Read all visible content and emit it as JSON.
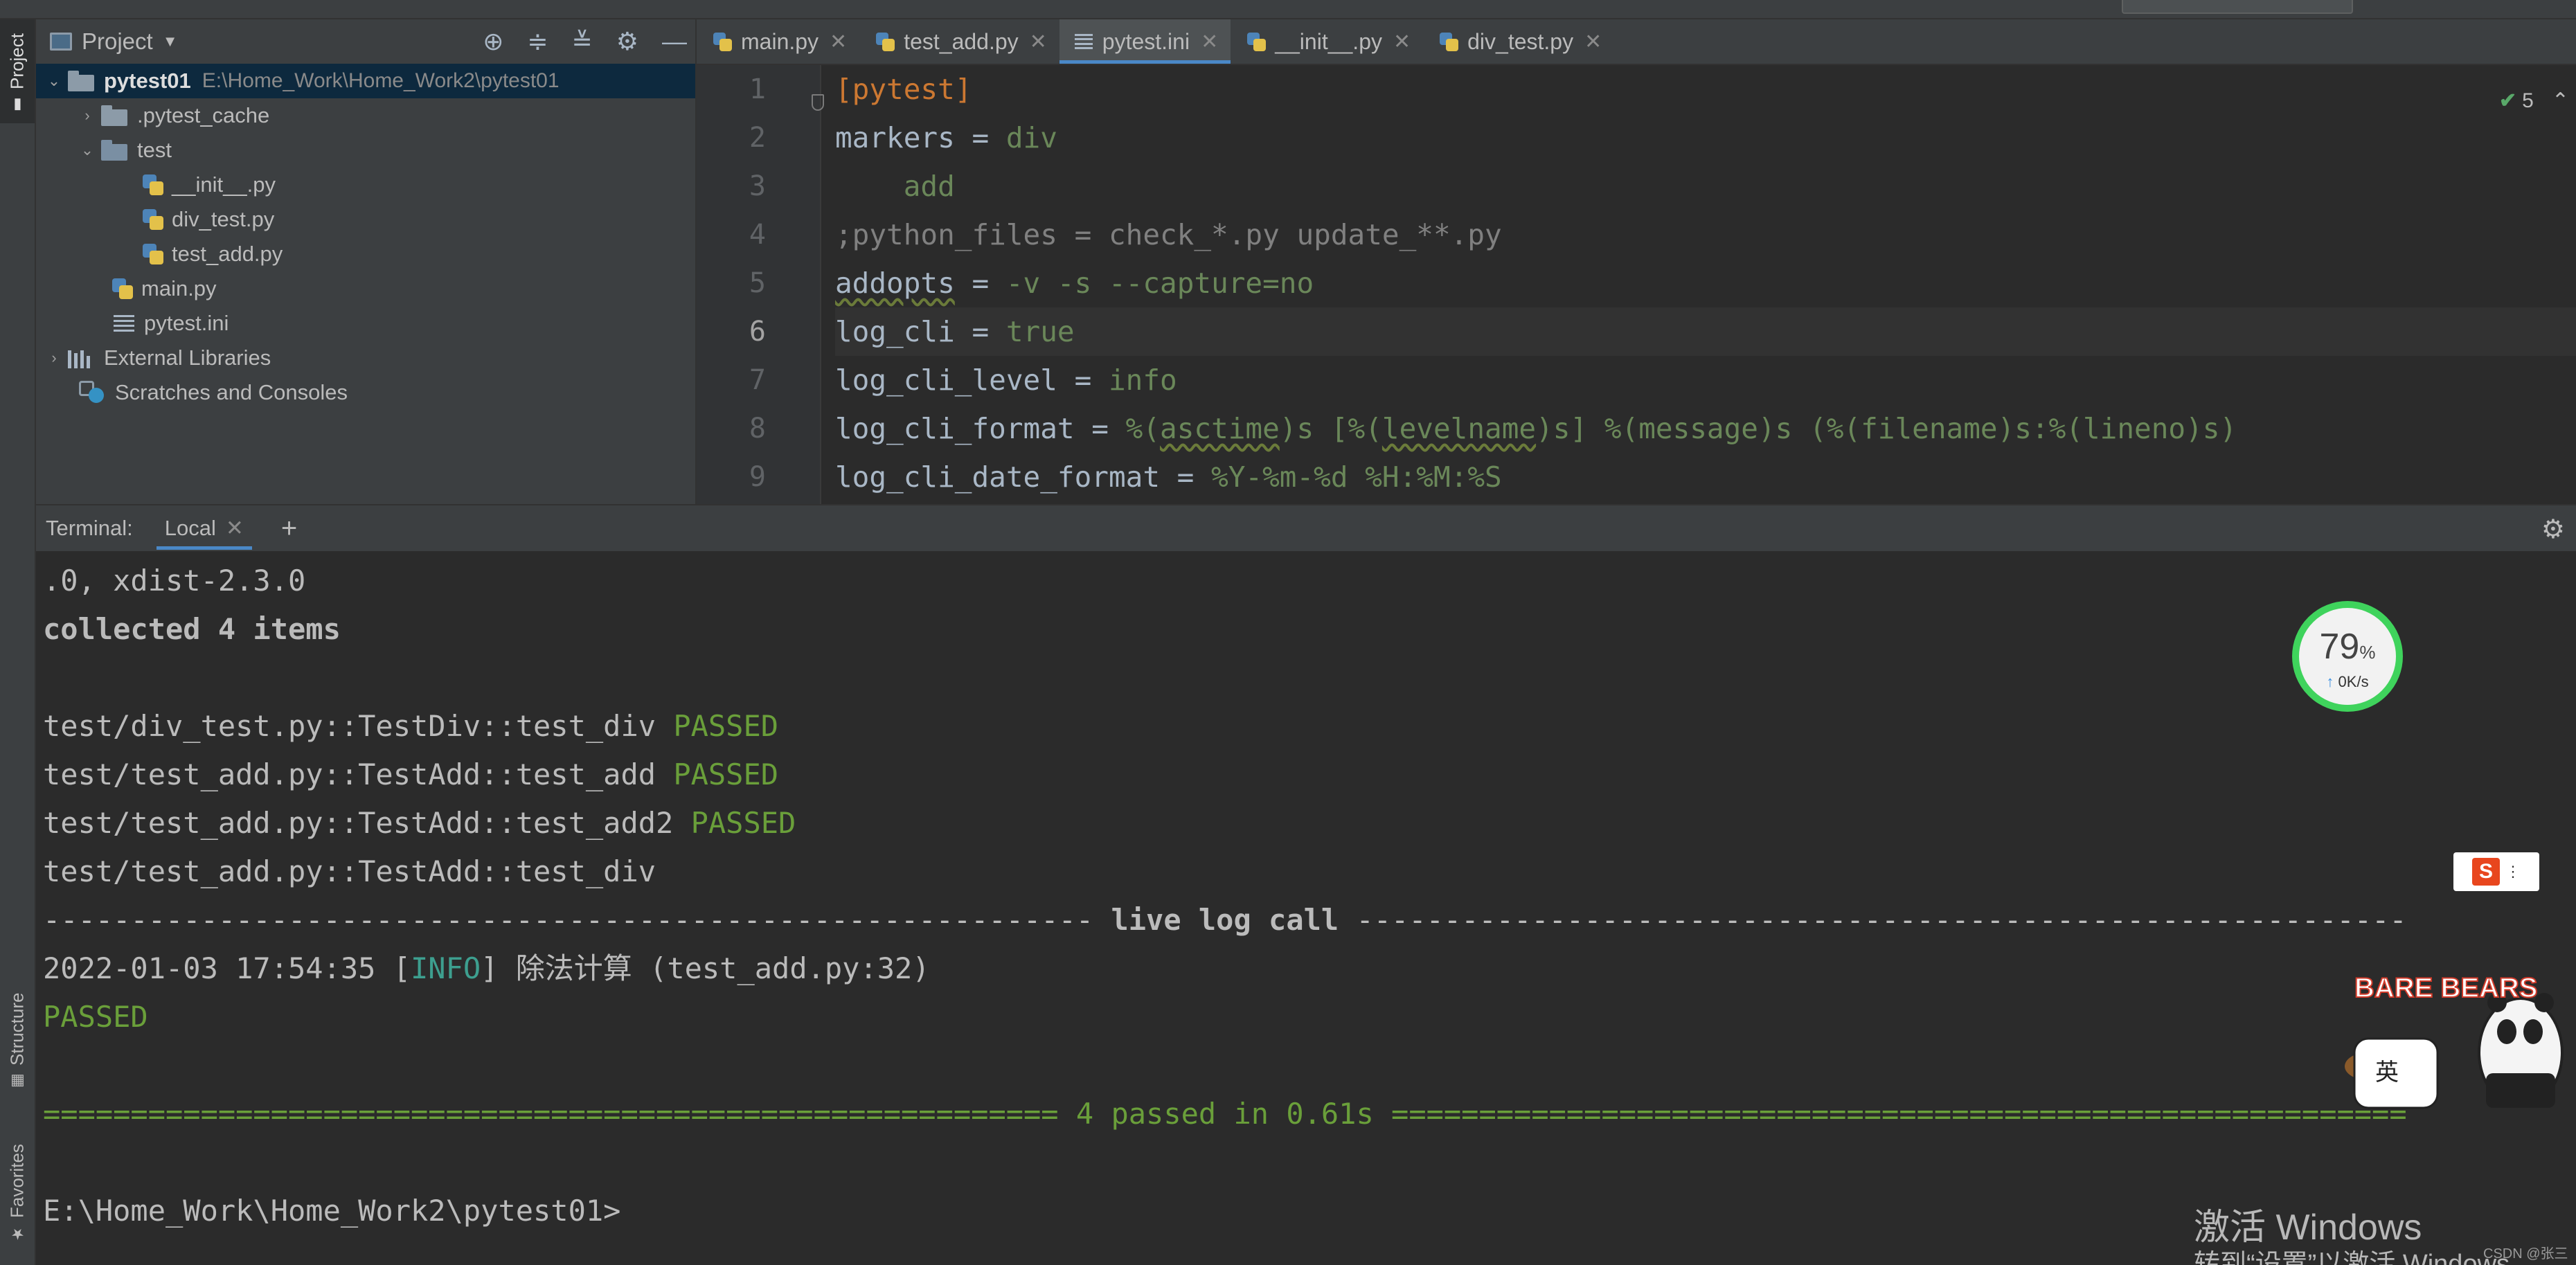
{
  "project_panel": {
    "title": "Project",
    "tree": [
      {
        "label": "pytest01",
        "path": "E:\\Home_Work\\Home_Work2\\pytest01"
      },
      {
        "label": ".pytest_cache"
      },
      {
        "label": "test"
      },
      {
        "label": "__init__.py"
      },
      {
        "label": "div_test.py"
      },
      {
        "label": "test_add.py"
      },
      {
        "label": "main.py"
      },
      {
        "label": "pytest.ini"
      },
      {
        "label": "External Libraries"
      },
      {
        "label": "Scratches and Consoles"
      }
    ]
  },
  "left_strip": {
    "project": "Project",
    "structure": "Structure",
    "favorites": "Favorites"
  },
  "editor": {
    "tabs": [
      "main.py",
      "test_add.py",
      "pytest.ini",
      "__init__.py",
      "div_test.py"
    ],
    "active_tab": "pytest.ini",
    "inspection_count": "5",
    "line_numbers": [
      "1",
      "2",
      "3",
      "4",
      "5",
      "6",
      "7",
      "8",
      "9"
    ],
    "current_line": "6",
    "code": {
      "l1": "[pytest]",
      "l2_key": "markers = ",
      "l2_val": "div",
      "l3_val": "add",
      "l4": ";python_files = check_*.py update_**.py",
      "l5_key": "addopts",
      "l5_eq": " = ",
      "l5_val": "-v -s --capture=no",
      "l6_key": "log_cli = ",
      "l6_val": "true",
      "l7_key": "log_cli_level = ",
      "l7_val": "info",
      "l8_key": "log_cli_format = ",
      "l8_v1": "%(",
      "l8_v2": "asctime",
      "l8_v3": ")s [%(",
      "l8_v4": "levelname",
      "l8_v5": ")s] %(message)s (%(filename)s:%(lineno)s)",
      "l9_key": "log_cli_date_format = ",
      "l9_val": "%Y-%m-%d %H:%M:%S"
    }
  },
  "terminal": {
    "label": "Terminal:",
    "tab": "Local",
    "lines": {
      "t1": ".0, xdist-2.3.0",
      "t2": "collected 4 items",
      "t3a": "test/div_test.py::TestDiv::test_div ",
      "t3b": "PASSED",
      "t4a": "test/test_add.py::TestAdd::test_add ",
      "t4b": "PASSED",
      "t5a": "test/test_add.py::TestAdd::test_add2 ",
      "t5b": "PASSED",
      "t6": "test/test_add.py::TestAdd::test_div",
      "t7a": "------------------------------------------------------------ ",
      "t7b": "live log call",
      "t7c": " ------------------------------------------------------------",
      "t8a": "2022-01-03 17:54:35 [",
      "t8b": "INFO",
      "t8c": "] 除法计算 (test_add.py:32)",
      "t9": "PASSED",
      "t10": "========================================================== 4 passed in 0.61s ==========================================================",
      "t11": "E:\\Home_Work\\Home_Work2\\pytest01>"
    }
  },
  "overlays": {
    "speed_percent": "79",
    "speed_unit": "%",
    "speed_rate": "0K/s",
    "ime_char": "英",
    "mascot_text": "BARE BEARS",
    "watermark_line1": "激活 Windows",
    "watermark_line2": "转到“设置”以激活 Windows。",
    "credit": "CSDN @张三",
    "accent": "#4a88c7",
    "pass_color": "#6a9f3a"
  }
}
